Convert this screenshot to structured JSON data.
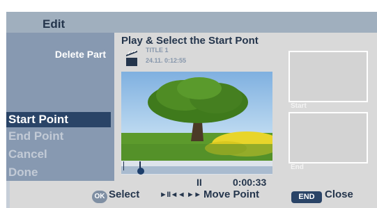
{
  "app": {
    "title": "Edit"
  },
  "left_panel": {
    "heading": "Delete Part"
  },
  "menu": {
    "items": [
      {
        "label": "Start Point",
        "selected": true
      },
      {
        "label": "End Point",
        "selected": false
      },
      {
        "label": "Cancel",
        "selected": false
      },
      {
        "label": "Done",
        "selected": false
      }
    ]
  },
  "main": {
    "title": "Play & Select the Start Pont",
    "clip_title": "TITLE 1",
    "clip_date_time": "24.11.  0:12:55",
    "playback_status": "II",
    "time": "0:00:33"
  },
  "thumbnails": {
    "start_label": "Start",
    "end_label": "End"
  },
  "footer": {
    "ok_badge": "OK",
    "select_label": "Select",
    "move_glyphs": "►II◄◄ ►►",
    "move_label": "Move Point",
    "end_badge": "END",
    "close_label": "Close"
  },
  "colors": {
    "selected_bg": "#2a4467",
    "panel_bg": "#8799b1",
    "header_bg": "#a0afbe",
    "text_dark": "#24354c"
  }
}
